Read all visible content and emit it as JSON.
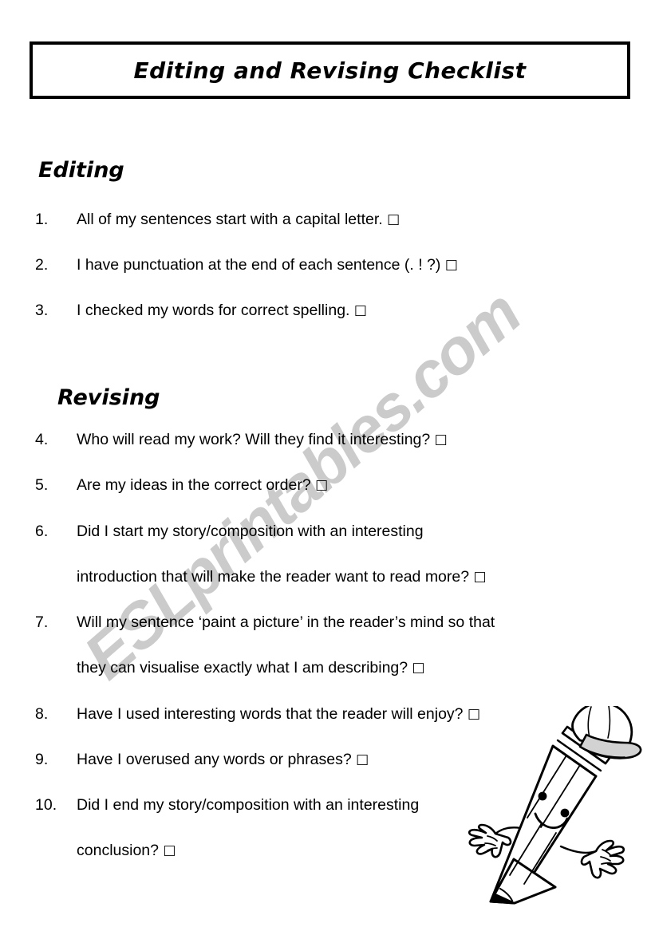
{
  "document": {
    "title": "Editing and Revising Checklist",
    "background_color": "#ffffff",
    "text_color": "#000000",
    "border_color": "#000000"
  },
  "watermark": {
    "text": "ESLprintables.com",
    "color": "#cbcbcb"
  },
  "sections": {
    "editing": {
      "heading": "Editing"
    },
    "revising": {
      "heading": "Revising"
    }
  },
  "checkbox_glyph": "□",
  "items": [
    {
      "number": "1.",
      "line1": "All of my sentences start with a capital letter.",
      "line2": ""
    },
    {
      "number": "2.",
      "line1": "I have punctuation at the end of each sentence (. ! ?)",
      "line2": ""
    },
    {
      "number": "3.",
      "line1": "I checked my words for correct spelling.",
      "line2": ""
    },
    {
      "number": "4.",
      "line1": "Who will read my work? Will they find it interesting?",
      "line2": ""
    },
    {
      "number": "5.",
      "line1": "Are my ideas in the correct order?",
      "line2": ""
    },
    {
      "number": "6.",
      "line1": "Did I start my story/composition with an interesting",
      "line2": "introduction that will make the reader want to read more?"
    },
    {
      "number": "7.",
      "line1": "Will my sentence ‘paint a picture’ in the reader’s mind so that",
      "line2": "they can visualise exactly what I am describing?"
    },
    {
      "number": "8.",
      "line1": " Have I used interesting words that the reader will enjoy?",
      "line2": ""
    },
    {
      "number": "9.",
      "line1": "Have I overused any words or phrases?",
      "line2": ""
    },
    {
      "number": "10.",
      "line1": "Did I end my story/composition with an interesting",
      "line2": "conclusion?"
    }
  ],
  "illustration": {
    "name": "smiling-pencil-mascot",
    "description": "line-art pencil character wearing a cap with a smiling face and two gloved hands"
  }
}
